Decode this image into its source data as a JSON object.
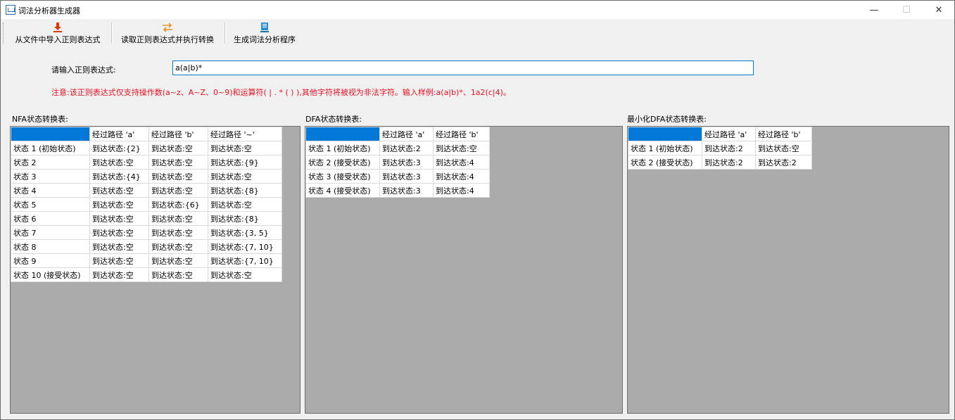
{
  "window": {
    "title": "词法分析器生成器",
    "min_glyph": "—",
    "max_glyph": "☐",
    "close_glyph": "✕"
  },
  "toolbar": {
    "import_label": "从文件中导入正则表达式",
    "convert_label": "读取正则表达式并执行转换",
    "generate_label": "生成词法分析程序",
    "import_icon": "download-icon",
    "convert_icon": "swap-arrows-icon",
    "generate_icon": "document-stack-icon"
  },
  "form": {
    "prompt_label": "请输入正则表达式:",
    "regex_value": "a(a|b)*",
    "notice": "注意:该正则表达式仅支持操作数(a~z、A~Z、0~9)和运算符( | . * ( ) ),其他字符将被视为非法字符。输入样例:a(a|b)*、1a2(c|4)。"
  },
  "nfa": {
    "title": "NFA状态转换表:",
    "headers": [
      "",
      "经过路径 'a'",
      "经过路径 'b'",
      "经过路径 '~'"
    ],
    "rows": [
      [
        "状态 1 (初始状态)",
        "到达状态:{2}",
        "到达状态:空",
        "到达状态:空"
      ],
      [
        "状态 2",
        "到达状态:空",
        "到达状态:空",
        "到达状态:{9}"
      ],
      [
        "状态 3",
        "到达状态:{4}",
        "到达状态:空",
        "到达状态:空"
      ],
      [
        "状态 4",
        "到达状态:空",
        "到达状态:空",
        "到达状态:{8}"
      ],
      [
        "状态 5",
        "到达状态:空",
        "到达状态:{6}",
        "到达状态:空"
      ],
      [
        "状态 6",
        "到达状态:空",
        "到达状态:空",
        "到达状态:{8}"
      ],
      [
        "状态 7",
        "到达状态:空",
        "到达状态:空",
        "到达状态:{3, 5}"
      ],
      [
        "状态 8",
        "到达状态:空",
        "到达状态:空",
        "到达状态:{7, 10}"
      ],
      [
        "状态 9",
        "到达状态:空",
        "到达状态:空",
        "到达状态:{7, 10}"
      ],
      [
        "状态 10 (接受状态)",
        "到达状态:空",
        "到达状态:空",
        "到达状态:空"
      ]
    ]
  },
  "dfa": {
    "title": "DFA状态转换表:",
    "headers": [
      "",
      "经过路径 'a'",
      "经过路径 'b'"
    ],
    "rows": [
      [
        "状态 1 (初始状态)",
        "到达状态:2",
        "到达状态:空"
      ],
      [
        "状态 2 (接受状态)",
        "到达状态:3",
        "到达状态:4"
      ],
      [
        "状态 3 (接受状态)",
        "到达状态:3",
        "到达状态:4"
      ],
      [
        "状态 4 (接受状态)",
        "到达状态:3",
        "到达状态:4"
      ]
    ]
  },
  "mindfa": {
    "title": "最小化DFA状态转换表:",
    "headers": [
      "",
      "经过路径 'a'",
      "经过路径 'b'"
    ],
    "rows": [
      [
        "状态 1 (初始状态)",
        "到达状态:2",
        "到达状态:空"
      ],
      [
        "状态 2 (接受状态)",
        "到达状态:2",
        "到达状态:2"
      ]
    ]
  },
  "colors": {
    "selection": "#0078d7",
    "notice": "#e81123",
    "grid_background": "#ababab"
  }
}
